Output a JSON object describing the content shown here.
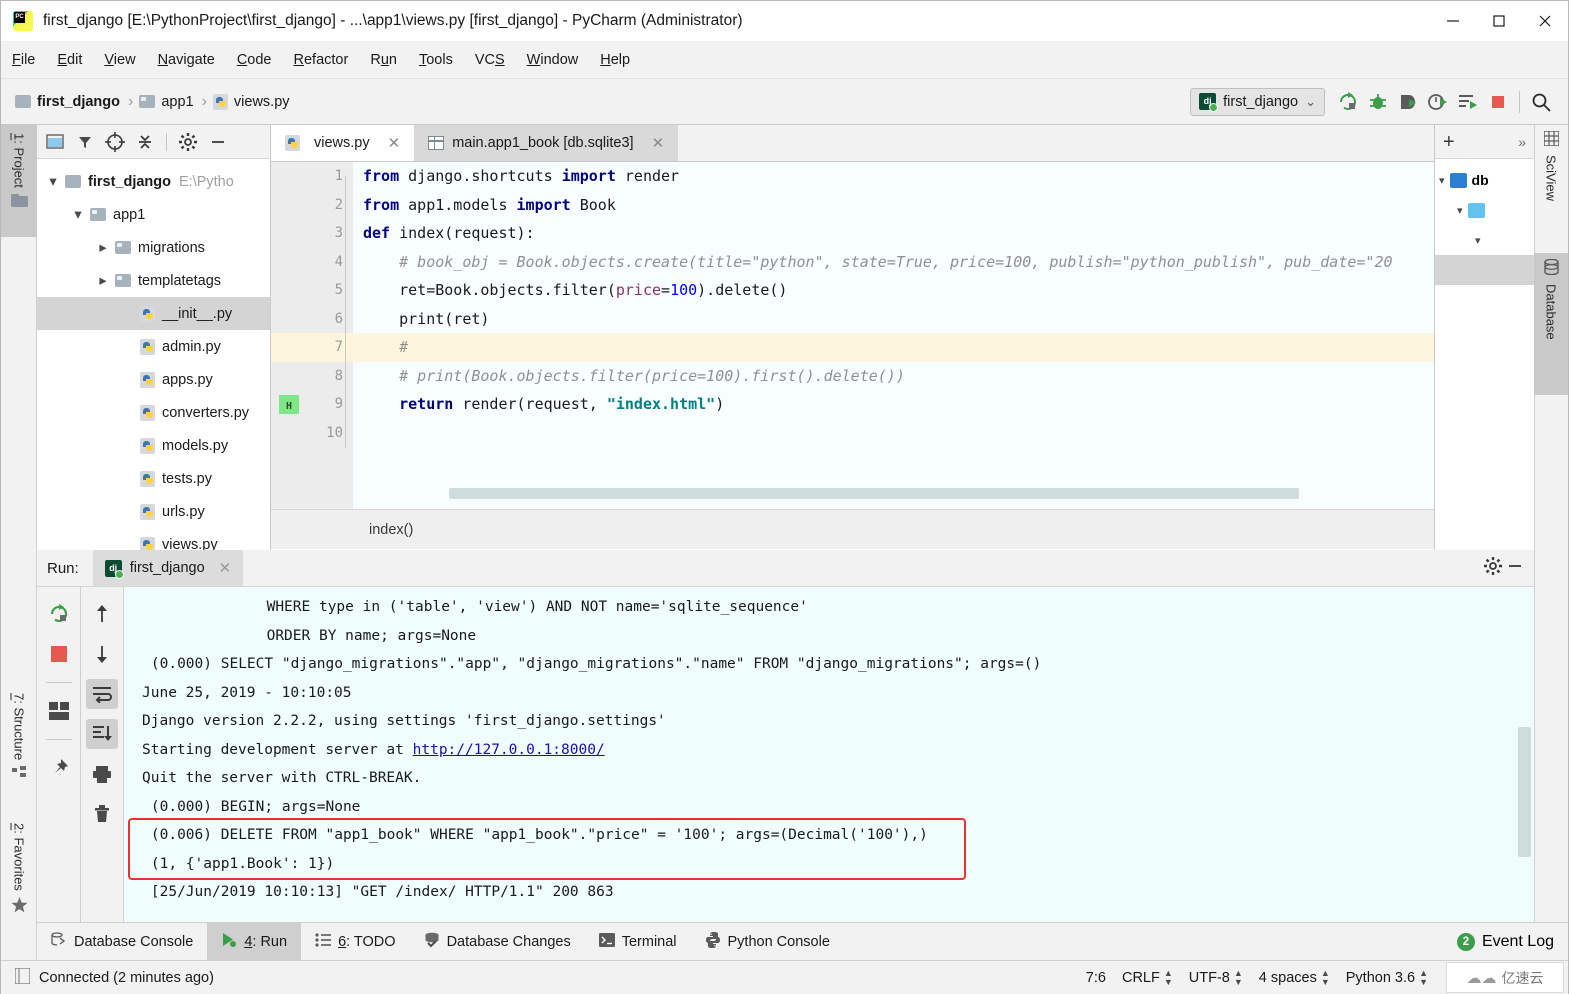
{
  "window": {
    "title": "first_django [E:\\PythonProject\\first_django] - ...\\app1\\views.py [first_django] - PyCharm (Administrator)",
    "app_icon": "pycharm-icon",
    "minimize_label": "–",
    "maximize_label": "□",
    "close_label": "✕"
  },
  "menubar": {
    "items": [
      {
        "label": "File",
        "mnemonic": "F"
      },
      {
        "label": "Edit",
        "mnemonic": "E"
      },
      {
        "label": "View",
        "mnemonic": "V"
      },
      {
        "label": "Navigate",
        "mnemonic": "N"
      },
      {
        "label": "Code",
        "mnemonic": "C"
      },
      {
        "label": "Refactor",
        "mnemonic": "R"
      },
      {
        "label": "Run",
        "mnemonic": "u"
      },
      {
        "label": "Tools",
        "mnemonic": "T"
      },
      {
        "label": "VCS",
        "mnemonic": "S"
      },
      {
        "label": "Window",
        "mnemonic": "W"
      },
      {
        "label": "Help",
        "mnemonic": "H"
      }
    ]
  },
  "breadcrumb": {
    "items": [
      "first_django",
      "app1",
      "views.py"
    ],
    "sep": "›"
  },
  "toolbar": {
    "run_config": "first_django",
    "chevron": "⌄",
    "icons": [
      "rerun-icon",
      "debug-icon",
      "coverage-icon",
      "profile-icon",
      "run-with-console-icon",
      "stop-icon",
      "search-everywhere-icon"
    ]
  },
  "left_tool_tabs": [
    {
      "label": "1: Project",
      "mnemonic": "1",
      "icon": "folder-icon",
      "active": true
    },
    {
      "label": "7: Structure",
      "mnemonic": "7",
      "icon": "structure-icon",
      "active": false
    },
    {
      "label": "2: Favorites",
      "mnemonic": "2",
      "icon": "star-icon",
      "active": false
    }
  ],
  "right_tool_tabs": [
    {
      "label": "SciView",
      "icon": "grid-icon",
      "active": false
    },
    {
      "label": "Database",
      "icon": "database-icon",
      "active": true
    }
  ],
  "project_panel": {
    "toolbar_icons": [
      "select-opened-file-icon",
      "locate-icon",
      "collapse-all-icon",
      "gear-icon",
      "hide-icon"
    ],
    "tree": [
      {
        "label": "first_django",
        "path": "E:\\Pytho",
        "indent": 0,
        "arrow": "down",
        "icon": "folder-icon",
        "bold": true,
        "selected": false
      },
      {
        "label": "app1",
        "indent": 1,
        "arrow": "down",
        "icon": "folder-open-icon",
        "bold": false,
        "selected": false
      },
      {
        "label": "migrations",
        "indent": 2,
        "arrow": "right",
        "icon": "folder-open-icon",
        "bold": false,
        "selected": false
      },
      {
        "label": "templatetags",
        "indent": 2,
        "arrow": "right",
        "icon": "folder-open-icon",
        "bold": false,
        "selected": false
      },
      {
        "label": "__init__.py",
        "indent": 3,
        "arrow": "none",
        "icon": "python-file-icon",
        "bold": false,
        "selected": true
      },
      {
        "label": "admin.py",
        "indent": 3,
        "arrow": "none",
        "icon": "python-file-icon",
        "bold": false,
        "selected": false
      },
      {
        "label": "apps.py",
        "indent": 3,
        "arrow": "none",
        "icon": "python-file-icon",
        "bold": false,
        "selected": false
      },
      {
        "label": "converters.py",
        "indent": 3,
        "arrow": "none",
        "icon": "python-file-icon",
        "bold": false,
        "selected": false
      },
      {
        "label": "models.py",
        "indent": 3,
        "arrow": "none",
        "icon": "python-file-icon",
        "bold": false,
        "selected": false
      },
      {
        "label": "tests.py",
        "indent": 3,
        "arrow": "none",
        "icon": "python-file-icon",
        "bold": false,
        "selected": false
      },
      {
        "label": "urls.py",
        "indent": 3,
        "arrow": "none",
        "icon": "python-file-icon",
        "bold": false,
        "selected": false
      },
      {
        "label": "views.py",
        "indent": 3,
        "arrow": "none",
        "icon": "python-file-icon",
        "bold": false,
        "selected": false
      }
    ]
  },
  "editor": {
    "tabs": [
      {
        "label": "views.py",
        "icon": "python-file-icon",
        "active": true,
        "close": "✕"
      },
      {
        "label": "main.app1_book [db.sqlite3]",
        "icon": "db-table-icon",
        "active": false,
        "close": "✕"
      }
    ],
    "line_numbers": [
      "1",
      "2",
      "3",
      "4",
      "5",
      "6",
      "7",
      "8",
      "9",
      "10"
    ],
    "highlighted_line": 7,
    "breadcrumb": "index()",
    "code": [
      {
        "n": 1,
        "segments": [
          {
            "t": "from",
            "c": "kw"
          },
          {
            "t": " django.shortcuts ",
            "c": ""
          },
          {
            "t": "import",
            "c": "kw"
          },
          {
            "t": " render",
            "c": ""
          }
        ]
      },
      {
        "n": 2,
        "segments": [
          {
            "t": "from",
            "c": "kw"
          },
          {
            "t": " app1.models ",
            "c": ""
          },
          {
            "t": "import",
            "c": "kw"
          },
          {
            "t": " Book",
            "c": ""
          }
        ]
      },
      {
        "n": 3,
        "segments": [
          {
            "t": "def",
            "c": "kw"
          },
          {
            "t": " index(request):",
            "c": ""
          }
        ]
      },
      {
        "n": 4,
        "segments": [
          {
            "t": "    # book_obj = Book.objects.create(title=\"python\", state=True, price=100, publish=\"python_publish\", pub_date=\"20",
            "c": "cmt"
          }
        ]
      },
      {
        "n": 5,
        "segments": [
          {
            "t": "    ret=Book.objects.filter(",
            "c": ""
          },
          {
            "t": "price",
            "c": "param"
          },
          {
            "t": "=",
            "c": ""
          },
          {
            "t": "100",
            "c": "num"
          },
          {
            "t": ").delete()",
            "c": ""
          }
        ]
      },
      {
        "n": 6,
        "segments": [
          {
            "t": "    print(ret)",
            "c": ""
          }
        ]
      },
      {
        "n": 7,
        "segments": [
          {
            "t": "    #",
            "c": "cmt"
          }
        ]
      },
      {
        "n": 8,
        "segments": [
          {
            "t": "    # print(Book.objects.filter(price=100).first().delete())",
            "c": "cmt"
          }
        ]
      },
      {
        "n": 9,
        "segments": [
          {
            "t": "    ",
            "c": ""
          },
          {
            "t": "return",
            "c": "kw"
          },
          {
            "t": " render(request, ",
            "c": ""
          },
          {
            "t": "\"index.html\"",
            "c": "str"
          },
          {
            "t": ")",
            "c": ""
          }
        ]
      },
      {
        "n": 10,
        "segments": [
          {
            "t": "",
            "c": ""
          }
        ]
      }
    ],
    "gutter_marker_line9": "H"
  },
  "db_panel": {
    "add_label": "+",
    "expand_label": "»",
    "rows": [
      {
        "label": "db",
        "icon": "datasource-icon",
        "arrow": "down",
        "indent": 0,
        "selected": false
      },
      {
        "label": "",
        "icon": "schema-icon",
        "arrow": "down",
        "indent": 1,
        "selected": false
      },
      {
        "label": "",
        "icon": "none",
        "arrow": "down",
        "indent": 2,
        "selected": false
      },
      {
        "label": "",
        "icon": "none",
        "arrow": "none",
        "indent": 2,
        "selected": true
      }
    ]
  },
  "run_panel": {
    "label": "Run:",
    "tab_label": "first_django",
    "tab_icon": "django-icon",
    "tab_close": "✕",
    "header_icons": [
      "gear-icon",
      "hide-icon"
    ],
    "left_tools": [
      "rerun-icon",
      "stop-icon",
      "layout-icon",
      "pin-icon"
    ],
    "right_tools": [
      "up-arrow-icon",
      "down-arrow-icon",
      "soft-wrap-icon",
      "scroll-to-end-icon",
      "print-icon",
      "trash-icon"
    ],
    "console_lines": [
      {
        "indent": 14,
        "text": "WHERE type in ('table', 'view') AND NOT name='sqlite_sequence'",
        "link": false
      },
      {
        "indent": 14,
        "text": "ORDER BY name; args=None",
        "link": false
      },
      {
        "indent": 1,
        "text": "(0.000) SELECT \"django_migrations\".\"app\", \"django_migrations\".\"name\" FROM \"django_migrations\"; args=()",
        "link": false
      },
      {
        "indent": 0,
        "text": "June 25, 2019 - 10:10:05",
        "link": false
      },
      {
        "indent": 0,
        "text": "Django version 2.2.2, using settings 'first_django.settings'",
        "link": false
      },
      {
        "indent": 0,
        "text": "Starting development server at ",
        "link_text": "http://127.0.0.1:8000/",
        "link": true
      },
      {
        "indent": 0,
        "text": "Quit the server with CTRL-BREAK.",
        "link": false
      },
      {
        "indent": 1,
        "text": "(0.000) BEGIN; args=None",
        "link": false
      },
      {
        "indent": 1,
        "text": "(0.006) DELETE FROM \"app1_book\" WHERE \"app1_book\".\"price\" = '100'; args=(Decimal('100'),)",
        "link": false
      },
      {
        "indent": 1,
        "text": "(1, {'app1.Book': 1})",
        "link": false
      },
      {
        "indent": 1,
        "text": "[25/Jun/2019 10:10:13] \"GET /index/ HTTP/1.1\" 200 863",
        "link": false
      }
    ],
    "highlight_color": "#e8322a"
  },
  "bottom_tabs": [
    {
      "label": "Database Console",
      "icon": "db-console-icon",
      "active": false,
      "mnemonic": ""
    },
    {
      "label": "4: Run",
      "icon": "run-icon",
      "active": true,
      "mnemonic": "4"
    },
    {
      "label": "6: TODO",
      "icon": "todo-icon",
      "active": false,
      "mnemonic": "6"
    },
    {
      "label": "Database Changes",
      "icon": "db-changes-icon",
      "active": false,
      "mnemonic": ""
    },
    {
      "label": "Terminal",
      "icon": "terminal-icon",
      "active": false,
      "mnemonic": ""
    },
    {
      "label": "Python Console",
      "icon": "python-icon",
      "active": false,
      "mnemonic": ""
    }
  ],
  "event_log": {
    "label": "Event Log",
    "count": "2"
  },
  "statusbar": {
    "connection": "Connected (2 minutes ago)",
    "connection_icon": "db-status-icon",
    "caret": "7:6",
    "line_sep": "CRLF",
    "encoding": "UTF-8",
    "indent": "4 spaces",
    "interpreter": "Python 3.6",
    "spinner": "↕"
  },
  "watermark": {
    "text": "亿速云",
    "icon": "cloud-icon"
  }
}
